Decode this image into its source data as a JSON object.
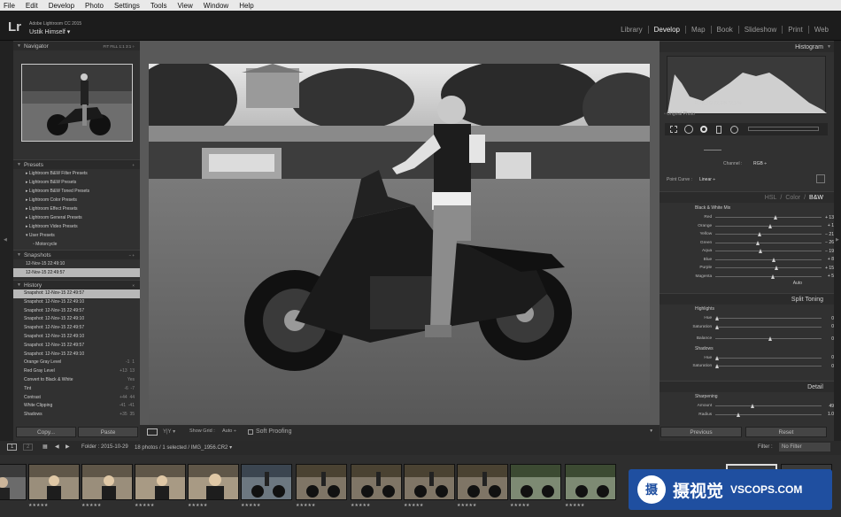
{
  "menu": [
    "File",
    "Edit",
    "Develop",
    "Photo",
    "Settings",
    "Tools",
    "View",
    "Window",
    "Help"
  ],
  "identity": {
    "logo": "Lr",
    "app": "Adobe Lightroom CC 2015",
    "user": "Ustik Himself ▾"
  },
  "modules": [
    {
      "label": "Library",
      "active": false
    },
    {
      "label": "Develop",
      "active": true
    },
    {
      "label": "Map",
      "active": false
    },
    {
      "label": "Book",
      "active": false
    },
    {
      "label": "Slideshow",
      "active": false
    },
    {
      "label": "Print",
      "active": false
    },
    {
      "label": "Web",
      "active": false
    }
  ],
  "navigator": {
    "title": "Navigator",
    "zoom": "FIT   FILL   1:1   3:1 ÷"
  },
  "presets": {
    "title": "Presets",
    "items": [
      "Lightroom B&W Filter Presets",
      "Lightroom B&W Presets",
      "Lightroom B&W Toned Presets",
      "Lightroom Color Presets",
      "Lightroom Effect Presets",
      "Lightroom General Presets",
      "Lightroom Video Presets",
      "User Presets",
      "Motorcycle"
    ]
  },
  "snapshots": {
    "title": "Snapshots",
    "items": [
      "12-Nov-15 22:49:10",
      "12-Nov-15 22:49:57"
    ],
    "selected": 1
  },
  "history": {
    "title": "History",
    "items": [
      {
        "label": "Snapshot: 12-Nov-15 22:49:57",
        "a": "",
        "b": ""
      },
      {
        "label": "Snapshot: 12-Nov-15 22:49:10",
        "a": "",
        "b": ""
      },
      {
        "label": "Snapshot: 12-Nov-15 22:49:57",
        "a": "",
        "b": ""
      },
      {
        "label": "Snapshot: 12-Nov-15 22:49:10",
        "a": "",
        "b": ""
      },
      {
        "label": "Snapshot: 12-Nov-15 22:49:57",
        "a": "",
        "b": ""
      },
      {
        "label": "Snapshot: 12-Nov-15 22:49:10",
        "a": "",
        "b": ""
      },
      {
        "label": "Snapshot: 12-Nov-15 22:49:57",
        "a": "",
        "b": ""
      },
      {
        "label": "Snapshot: 12-Nov-15 22:49:10",
        "a": "",
        "b": ""
      },
      {
        "label": "Orange Gray Level",
        "a": "-1",
        "b": "1"
      },
      {
        "label": "Red Gray Level",
        "a": "+13",
        "b": "13"
      },
      {
        "label": "Convert to Black & White",
        "a": "",
        "b": "Yes"
      },
      {
        "label": "Tint",
        "a": "-6",
        "b": "-7"
      },
      {
        "label": "Contrast",
        "a": "+44",
        "b": "44"
      },
      {
        "label": "White Clipping",
        "a": "-41",
        "b": "-41"
      },
      {
        "label": "Shadows",
        "a": "+35",
        "b": "35"
      }
    ],
    "selected": 0
  },
  "left_buttons": {
    "copy": "Copy...",
    "paste": "Paste"
  },
  "toolbar": {
    "show_grid": "Show Grid :",
    "auto": "Auto ÷",
    "soft_proofing": "Soft Proofing"
  },
  "histogram": {
    "title": "Histogram",
    "readout": "R  72.3  G  72.3  B  72.3  %",
    "original_photo": "Original Photo"
  },
  "tone_curve": {
    "channel_label": "Channel :",
    "channel_value": "RGB ÷",
    "point_curve_label": "Point Curve :",
    "point_curve_value": "Linear ÷"
  },
  "hsl": {
    "tabs": [
      "HSL",
      "Color",
      "B&W"
    ],
    "active": 2
  },
  "bw_mix": {
    "title": "Black & White Mix",
    "channels": [
      {
        "label": "Red",
        "value": "+ 13",
        "pos": 0.55
      },
      {
        "label": "Orange",
        "value": "+ 1",
        "pos": 0.5
      },
      {
        "label": "Yellow",
        "value": "− 21",
        "pos": 0.4
      },
      {
        "label": "Green",
        "value": "− 26",
        "pos": 0.38
      },
      {
        "label": "Aqua",
        "value": "− 19",
        "pos": 0.41
      },
      {
        "label": "Blue",
        "value": "+ 8",
        "pos": 0.53
      },
      {
        "label": "Purple",
        "value": "+ 15",
        "pos": 0.56
      },
      {
        "label": "Magenta",
        "value": "+ 5",
        "pos": 0.52
      }
    ],
    "auto": "Auto"
  },
  "split_toning": {
    "title": "Split Toning",
    "highlights": "Highlights",
    "shadows": "Shadows",
    "hue": "Hue",
    "saturation": "Saturation",
    "balance": "Balance",
    "values": [
      "0",
      "0",
      "0",
      "0",
      "0"
    ]
  },
  "detail": {
    "title": "Detail",
    "sharpening": "Sharpening",
    "rows": [
      {
        "label": "Amount",
        "value": "49"
      },
      {
        "label": "Radius",
        "value": "1.0"
      }
    ]
  },
  "right_buttons": {
    "previous": "Previous",
    "reset": "Reset"
  },
  "filmbar": {
    "pages": [
      "1",
      "2"
    ],
    "folder": "Folder : 2015-10-29",
    "count": "18 photos / 1 selected / IMG_1956.CR2 ▾",
    "filter_label": "Filter :",
    "filter_value": "No Filter"
  },
  "watermark": {
    "logo": "摄",
    "cn": "摄视觉",
    "en": "VSCOPS.COM"
  }
}
